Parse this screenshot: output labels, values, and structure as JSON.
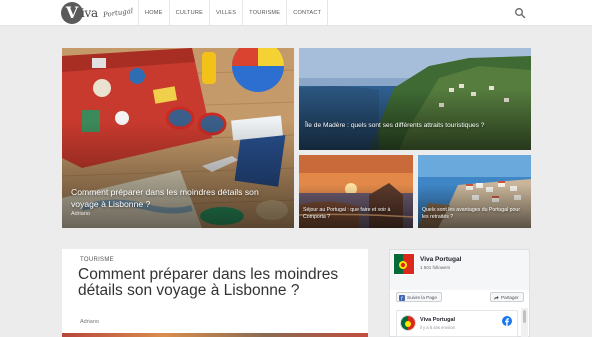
{
  "header": {
    "logo_letter": "V",
    "logo_word": "iva",
    "logo_script": "Portugal",
    "nav": [
      "HOME",
      "CULTURE",
      "VILLES",
      "TOURISME",
      "CONTACT"
    ],
    "search_icon": "search-icon"
  },
  "hero": [
    {
      "title": "Comment préparer dans les moindres détails son voyage à Lisbonne ?",
      "author": "Adriano"
    },
    {
      "title": "Île de Madère : quels sont ses différents attraits touristiques ?"
    },
    {
      "title": "Séjour au Portugal : que faire et voir à Comporta ?"
    },
    {
      "title": "Quels sont les avantages du Portugal pour les retraités ?"
    }
  ],
  "article": {
    "category": "TOURISME",
    "title": "Comment préparer dans les moindres détails son voyage à Lisbonne ?",
    "author": "Adriano"
  },
  "facebook": {
    "page_name": "Viva Portugal",
    "followers": "1 501 followers",
    "follow_label": "Suivre la Page",
    "share_label": "Partager",
    "post_name": "Viva Portugal",
    "post_time": "il y a 6 ans environ",
    "brand_color": "#1877f2"
  }
}
